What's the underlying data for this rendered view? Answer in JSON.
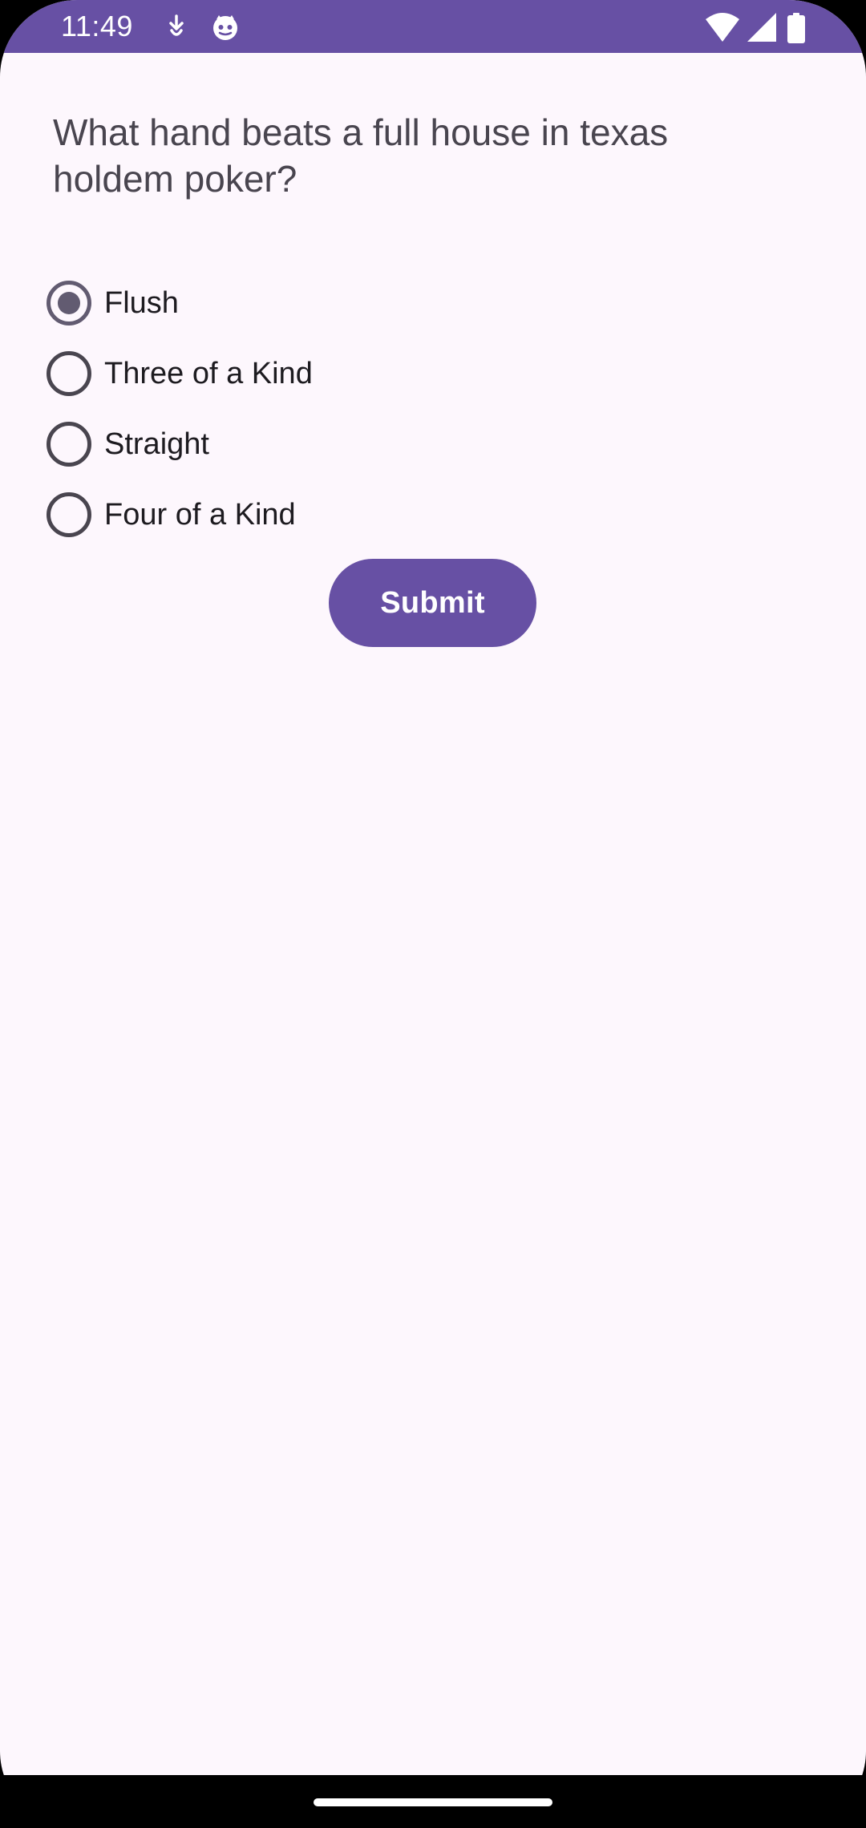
{
  "status_bar": {
    "time": "11:49",
    "left_icons": [
      "download-notification-icon",
      "app-notification-icon"
    ],
    "right_icons": [
      "wifi-icon",
      "cell-signal-icon",
      "battery-icon"
    ],
    "background": "#6750A4"
  },
  "quiz": {
    "question": "What hand beats a full house in texas holdem poker?",
    "options": [
      {
        "label": "Flush",
        "selected": true
      },
      {
        "label": "Three of a Kind",
        "selected": false
      },
      {
        "label": "Straight",
        "selected": false
      },
      {
        "label": "Four of a Kind",
        "selected": false
      }
    ],
    "submit_label": "Submit"
  },
  "colors": {
    "primary": "#6750A4",
    "background": "#FDF7FD",
    "text": "#1D1B20",
    "question_text": "#49454F"
  }
}
